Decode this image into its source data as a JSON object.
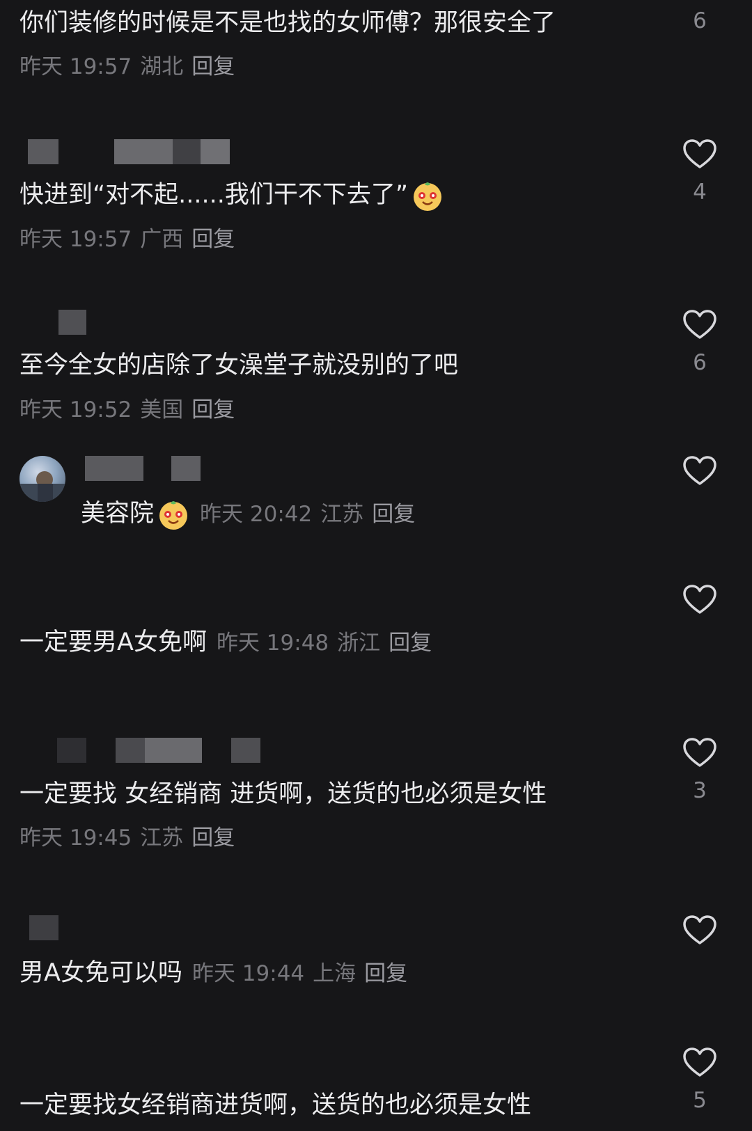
{
  "comments": [
    {
      "text": "你们装修的时候是不是也找的女师傅？那很安全了",
      "time": "昨天 19:57",
      "location": "湖北",
      "reply": "回复",
      "likes": "6"
    },
    {
      "text": "快进到“对不起......我们干不下去了”",
      "time": "昨天 19:57",
      "location": "广西",
      "reply": "回复",
      "likes": "4",
      "emoji": "laughing-face-emoji"
    },
    {
      "text": "至今全女的店除了女澡堂子就没别的了吧",
      "time": "昨天 19:52",
      "location": "美国",
      "reply": "回复",
      "likes": "6"
    },
    {
      "text": "美容院",
      "time": "昨天 20:42",
      "location": "江苏",
      "reply": "回复",
      "emoji": "laughing-face-emoji"
    },
    {
      "text": "一定要男A女免啊",
      "time": "昨天 19:48",
      "location": "浙江",
      "reply": "回复"
    },
    {
      "text": "一定要找 女经销商 进货啊，送货的也必须是女性",
      "time": "昨天 19:45",
      "location": "江苏",
      "reply": "回复",
      "likes": "3"
    },
    {
      "text": "男A女免可以吗",
      "time": "昨天 19:44",
      "location": "上海",
      "reply": "回复"
    },
    {
      "text": "一定要找女经销商进货啊，送货的也必须是女性",
      "likes": "5"
    }
  ],
  "colors": {
    "background": "#161618",
    "text": "#ececee",
    "meta": "#77777c",
    "icon": "#d8d8dc"
  },
  "icons": {
    "like": "heart-outline-icon",
    "emoji": "laughing-face-emoji"
  }
}
